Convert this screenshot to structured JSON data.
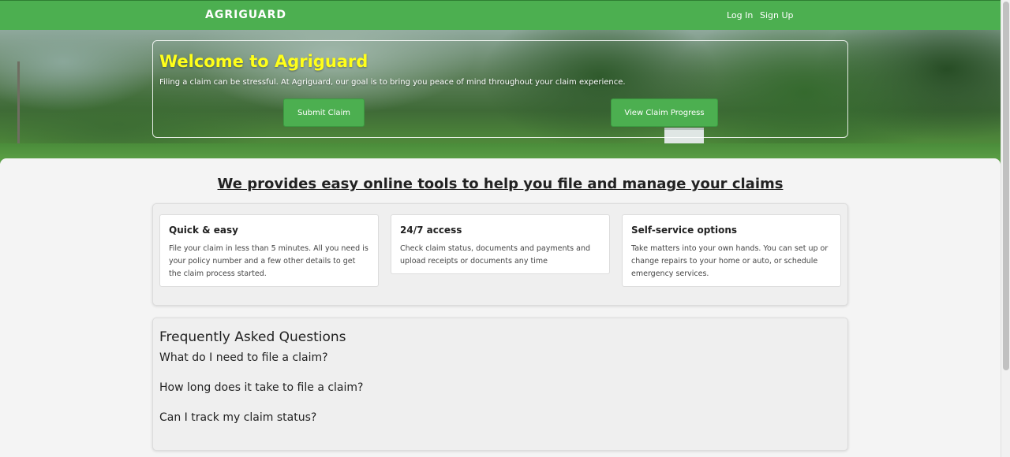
{
  "navbar": {
    "brand": "AGRIGUARD",
    "login_label": "Log In",
    "signup_label": "Sign Up"
  },
  "hero": {
    "title": "Welcome to Agriguard",
    "subtitle": "Filing a claim can be stressful. At Agriguard, our goal is to bring you peace of mind throughout your claim experience.",
    "submit_label": "Submit Claim",
    "progress_label": "View Claim Progress"
  },
  "main": {
    "tagline": "We provides easy online tools to help you file and manage your claims",
    "features": [
      {
        "title": "Quick & easy",
        "text": "File your claim in less than 5 minutes. All you need is your policy number and a few other details to get the claim process started."
      },
      {
        "title": "24/7 access",
        "text": "Check claim status, documents and payments and upload receipts or documents any time"
      },
      {
        "title": "Self-service options",
        "text": "Take matters into your own hands. You can set up or change repairs to your home or auto, or schedule emergency services."
      }
    ]
  },
  "faq": {
    "title": "Frequently Asked Questions",
    "questions": [
      "What do I need to file a claim?",
      "How long does it take to file a claim?",
      "Can I track my claim status?"
    ]
  },
  "colors": {
    "accent": "#4caf50",
    "hero_title": "#ffff1a"
  }
}
